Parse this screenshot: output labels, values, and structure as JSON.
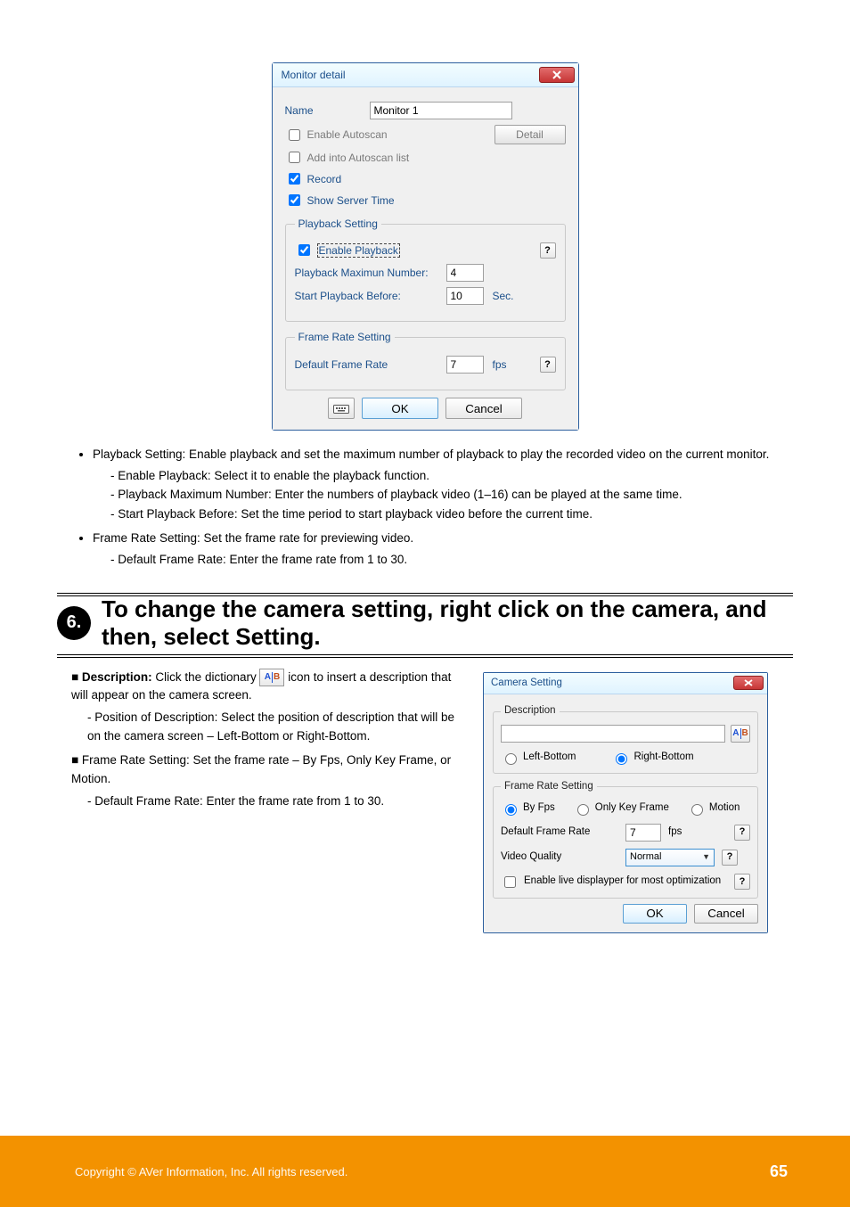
{
  "dialog1": {
    "title": "Monitor detail",
    "name_label": "Name",
    "name_value": "Monitor 1",
    "enable_autoscan": "Enable Autoscan",
    "detail_btn": "Detail",
    "add_autoscan": "Add into Autoscan list",
    "record": "Record",
    "show_server_time": "Show Server Time",
    "playback_legend": "Playback Setting",
    "enable_playback": "Enable Playback",
    "playback_max_label": "Playback Maximun Number:",
    "playback_max_value": "4",
    "start_before_label": "Start Playback Before:",
    "start_before_value": "10",
    "sec": "Sec.",
    "framerate_legend": "Frame Rate Setting",
    "default_fr_label": "Default Frame Rate",
    "default_fr_value": "7",
    "fps": "fps",
    "ok": "OK",
    "cancel": "Cancel",
    "help": "?"
  },
  "text": {
    "para1": "Playback Setting: Enable playback and set the maximum number of playback to play the recorded video on the current monitor.",
    "li1a": "Enable Playback: Select it to enable the playback function.",
    "li1b_p1": "Playback Maximum Number: Enter the numbers of playback video (1",
    "li1b_ndash": "–",
    "li1b_p2": "16) can be played at the same time.",
    "li1c": "Start Playback Before: Set the time period to start playback video before the current time.",
    "para2": "Frame Rate Setting: Set the frame rate for previewing video.",
    "li2a": "Default Frame Rate: Enter the frame rate from 1 to 30."
  },
  "section6": {
    "num": "6.",
    "title_prefix": "To change the camera setting,",
    "title_rest": " right click on the camera, and then, select Setting.",
    "desc_label": "Description:",
    "desc_body_1": " Click the dictionary ",
    "desc_body_2": " icon to insert a description that will appear on the camera screen.",
    "pos_p1": "Position of Description: ",
    "pos_p2": "Select the position of description that will be on the camera screen ",
    "pos_dash": "–",
    "pos_p3": " Left-Bottom or Right-Bottom.",
    "frs_p1": "Frame Rate Setting: Set the frame rate ",
    "frs_dash": "–",
    "frs_p2": "By Fps, Only Key Frame, or Motion.",
    "dfr": "Default Frame Rate: Enter the frame rate from 1 to 30."
  },
  "dialog2": {
    "title": "Camera Setting",
    "description_legend": "Description",
    "left_bottom": "Left-Bottom",
    "right_bottom": "Right-Bottom",
    "frs_legend": "Frame Rate Setting",
    "by_fps": "By Fps",
    "only_key": "Only Key Frame",
    "motion": "Motion",
    "default_fr": "Default Frame Rate",
    "fr_value": "7",
    "fps": "fps",
    "video_quality": "Video Quality",
    "quality_value": "Normal",
    "enable_live": "Enable live displayper for most optimization",
    "ok": "OK",
    "cancel": "Cancel",
    "help": "?"
  },
  "footer": {
    "copy": "Copyright © AVer Information, Inc. All rights reserved.",
    "page": "65"
  }
}
